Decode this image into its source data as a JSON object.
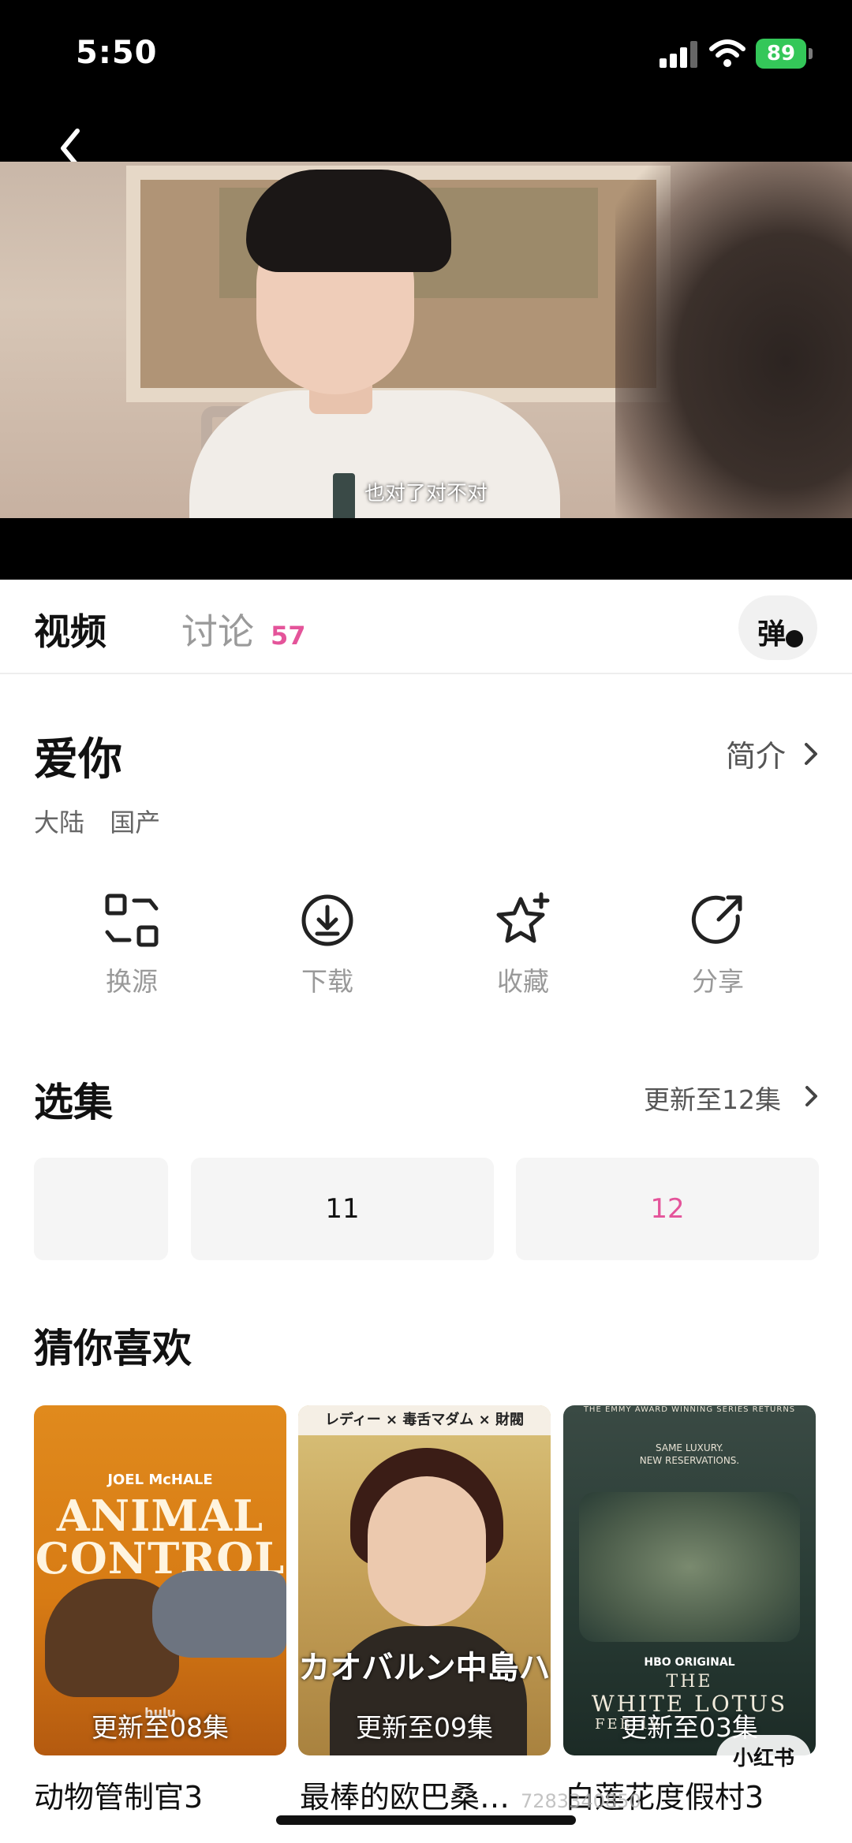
{
  "status_bar": {
    "time": "5:50",
    "battery": "89"
  },
  "video": {
    "subtitle": "也对了对不对"
  },
  "tabs": {
    "video": "视频",
    "discussion": "讨论",
    "discussion_count": "57",
    "danmaku": "弹"
  },
  "show": {
    "title": "爱你",
    "intro": "简介",
    "tags": [
      "大陆",
      "国产"
    ]
  },
  "actions": [
    {
      "label": "换源",
      "icon": "switch-source-icon"
    },
    {
      "label": "下载",
      "icon": "download-icon"
    },
    {
      "label": "收藏",
      "icon": "favorite-star-icon"
    },
    {
      "label": "分享",
      "icon": "share-icon"
    }
  ],
  "episodes": {
    "title": "选集",
    "update": "更新至12集",
    "items": [
      {
        "label": ""
      },
      {
        "label": "11"
      },
      {
        "label": "12",
        "current": true
      }
    ],
    "current_color": "#e4549a"
  },
  "recommend": {
    "title": "猜你喜欢",
    "items": [
      {
        "title": "动物管制官3",
        "badge": "更新至08集",
        "poster_text": {
          "actor": "JOEL McHALE",
          "line1": "ANIMAL",
          "line2": "CONTROL",
          "network": "hulu"
        }
      },
      {
        "title": "最棒的欧巴桑…",
        "badge": "更新至09集",
        "poster_text": {
          "top": "レディー × 毒舌マダム × 財閥",
          "main": "カオバルン中島ハ"
        }
      },
      {
        "title": "白莲花度假村3",
        "badge": "更新至03集",
        "poster_text": {
          "tagline": "THE EMMY AWARD WINNING SERIES RETURNS",
          "sub1": "SAME LUXURY.",
          "sub2": "NEW RESERVATIONS.",
          "hbo": "HBO ORIGINAL",
          "line1": "THE",
          "line2": "WHITE LOTUS",
          "date": "FEB 16"
        }
      }
    ]
  },
  "watermark": {
    "brand": "小红书",
    "id": "7283340850"
  },
  "colors": {
    "accent": "#e4549a",
    "battery": "#34c759"
  }
}
